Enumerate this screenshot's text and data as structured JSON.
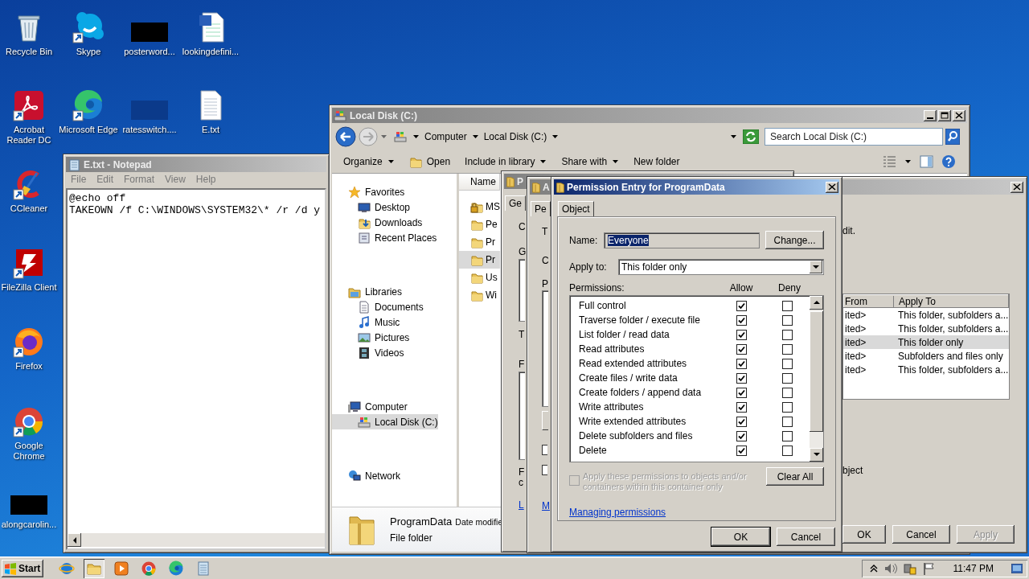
{
  "desktop_icons": [
    {
      "label": "Recycle Bin",
      "kind": "recycle",
      "shortcut": false
    },
    {
      "label": "Skype",
      "kind": "skype",
      "shortcut": true
    },
    {
      "label": "posterword...",
      "kind": "redacted",
      "shortcut": false
    },
    {
      "label": "lookingdefini...",
      "kind": "word",
      "shortcut": false
    },
    {
      "label": "Acrobat Reader DC",
      "kind": "acrobat",
      "shortcut": true
    },
    {
      "label": "Microsoft Edge",
      "kind": "edge",
      "shortcut": true
    },
    {
      "label": "ratesswitch....",
      "kind": "redacted_blue",
      "shortcut": false
    },
    {
      "label": "E.txt",
      "kind": "text",
      "shortcut": false
    },
    {
      "label": "CCleaner",
      "kind": "ccleaner",
      "shortcut": true
    },
    {
      "label": "FileZilla Client",
      "kind": "filezilla",
      "shortcut": true
    },
    {
      "label": "Firefox",
      "kind": "firefox",
      "shortcut": true
    },
    {
      "label": "Google Chrome",
      "kind": "chrome",
      "shortcut": true
    },
    {
      "label": "alongcarolin...",
      "kind": "redacted",
      "shortcut": false
    }
  ],
  "notepad": {
    "title": "E.txt - Notepad",
    "active": false,
    "menu": [
      "File",
      "Edit",
      "Format",
      "View",
      "Help"
    ],
    "lines": [
      "@echo off",
      "TAKEOWN /f C:\\WINDOWS\\SYSTEM32\\* /r /d y"
    ]
  },
  "explorer": {
    "title": "Local Disk (C:)",
    "active": false,
    "breadcrumb": [
      "Computer",
      "Local Disk (C:)"
    ],
    "search_placeholder": "Search Local Disk (C:)",
    "toolbar": [
      {
        "label": "Organize",
        "menu": true
      },
      {
        "label": "Open",
        "menu": false
      },
      {
        "label": "Include in library",
        "menu": true
      },
      {
        "label": "Share with",
        "menu": true
      },
      {
        "label": "New folder",
        "menu": false
      }
    ],
    "navigation": [
      {
        "label": "Favorites",
        "kind": "favorites",
        "selected": false,
        "children": [
          {
            "label": "Desktop",
            "kind": "desktop",
            "selected": false
          },
          {
            "label": "Downloads",
            "kind": "downloads",
            "selected": false
          },
          {
            "label": "Recent Places",
            "kind": "recent",
            "selected": false
          }
        ]
      },
      {
        "label": "Libraries",
        "kind": "libraries",
        "selected": false,
        "children": [
          {
            "label": "Documents",
            "kind": "documents",
            "selected": false
          },
          {
            "label": "Music",
            "kind": "music",
            "selected": false
          },
          {
            "label": "Pictures",
            "kind": "pictures",
            "selected": false
          },
          {
            "label": "Videos",
            "kind": "videos",
            "selected": false
          }
        ]
      },
      {
        "label": "Computer",
        "kind": "computer",
        "selected": false,
        "children": [
          {
            "label": "Local Disk (C:)",
            "kind": "drive",
            "selected": true
          }
        ]
      },
      {
        "label": "Network",
        "kind": "network",
        "selected": false
      }
    ],
    "file_list": {
      "column": "Name",
      "items": [
        {
          "name": "MS",
          "kind": "locked",
          "selected": false
        },
        {
          "name": "Pe",
          "kind": "folder",
          "selected": false
        },
        {
          "name": "Pr",
          "kind": "folder",
          "selected": false
        },
        {
          "name": "Pr",
          "kind": "folder",
          "selected": true
        },
        {
          "name": "Us",
          "kind": "folder",
          "selected": false
        },
        {
          "name": "Wi",
          "kind": "folder",
          "selected": false
        }
      ]
    },
    "details": {
      "name": "ProgramData",
      "date_label": "Date modifie",
      "type": "File folder"
    }
  },
  "properties_dialog": {
    "title": "P",
    "active": false,
    "tab": "Ge",
    "fragments": [
      {
        "kind": "label",
        "text": "C"
      },
      {
        "kind": "label",
        "text": "G"
      },
      {
        "kind": "list"
      },
      {
        "kind": "label",
        "text": "T"
      },
      {
        "kind": "label",
        "text": "F"
      },
      {
        "kind": "list"
      },
      {
        "kind": "label",
        "text": "F"
      },
      {
        "kind": "label",
        "text": "c"
      },
      {
        "kind": "link",
        "text": "L"
      }
    ]
  },
  "security_dialog": {
    "title": "A",
    "active": false,
    "tab": "Pe",
    "fragments": [
      {
        "kind": "label",
        "text": "T"
      },
      {
        "kind": "label",
        "text": "C"
      },
      {
        "kind": "label",
        "text": "P"
      },
      {
        "kind": "list"
      },
      {
        "kind": "button"
      },
      {
        "kind": "checkbox",
        "checked": false
      },
      {
        "kind": "checkbox",
        "checked": false
      },
      {
        "kind": "link",
        "text": "M"
      }
    ],
    "note": "dit.",
    "table": {
      "columns": [
        "From",
        "Apply To"
      ],
      "rows": [
        {
          "from": "ited>",
          "apply_to": "This folder, subfolders a...",
          "selected": false
        },
        {
          "from": "ited>",
          "apply_to": "This folder, subfolders a...",
          "selected": false
        },
        {
          "from": "ited>",
          "apply_to": "This folder only",
          "selected": true
        },
        {
          "from": "ited>",
          "apply_to": "Subfolders and files only",
          "selected": false
        },
        {
          "from": "ited>",
          "apply_to": "This folder, subfolders a...",
          "selected": false
        }
      ]
    },
    "note_2": "bject",
    "buttons": [
      {
        "label": "OK",
        "disabled": false
      },
      {
        "label": "Cancel",
        "disabled": false
      },
      {
        "label": "Apply",
        "disabled": true
      }
    ]
  },
  "permission_dialog": {
    "title": "Permission Entry for ProgramData",
    "active": true,
    "tab": "Object",
    "name_label": "Name:",
    "name_value": "Everyone",
    "change_button": "Change...",
    "apply_label": "Apply to:",
    "apply_value": "This folder only",
    "permissions_label": "Permissions:",
    "allow_label": "Allow",
    "deny_label": "Deny",
    "permissions": [
      {
        "name": "Full control",
        "allow": true,
        "deny": false
      },
      {
        "name": "Traverse folder / execute file",
        "allow": true,
        "deny": false
      },
      {
        "name": "List folder / read data",
        "allow": true,
        "deny": false
      },
      {
        "name": "Read attributes",
        "allow": true,
        "deny": false
      },
      {
        "name": "Read extended attributes",
        "allow": true,
        "deny": false
      },
      {
        "name": "Create files / write data",
        "allow": true,
        "deny": false
      },
      {
        "name": "Create folders / append data",
        "allow": true,
        "deny": false
      },
      {
        "name": "Write attributes",
        "allow": true,
        "deny": false
      },
      {
        "name": "Write extended attributes",
        "allow": true,
        "deny": false
      },
      {
        "name": "Delete subfolders and files",
        "allow": true,
        "deny": false
      },
      {
        "name": "Delete",
        "allow": true,
        "deny": false
      }
    ],
    "apply_inherit": {
      "label": "Apply these permissions to objects and/or containers within this container only",
      "checked": false,
      "disabled": true
    },
    "clear_button": "Clear All",
    "help_link": "Managing permissions",
    "buttons": [
      "OK",
      "Cancel"
    ]
  },
  "taskbar": {
    "start": "Start",
    "apps": [
      {
        "kind": "ie",
        "active": false
      },
      {
        "kind": "explorer",
        "active": true
      },
      {
        "kind": "media",
        "active": false
      },
      {
        "kind": "chrome",
        "active": false
      },
      {
        "kind": "edge",
        "active": false
      },
      {
        "kind": "notepad",
        "active": false
      }
    ],
    "clock": "11:47 PM"
  }
}
